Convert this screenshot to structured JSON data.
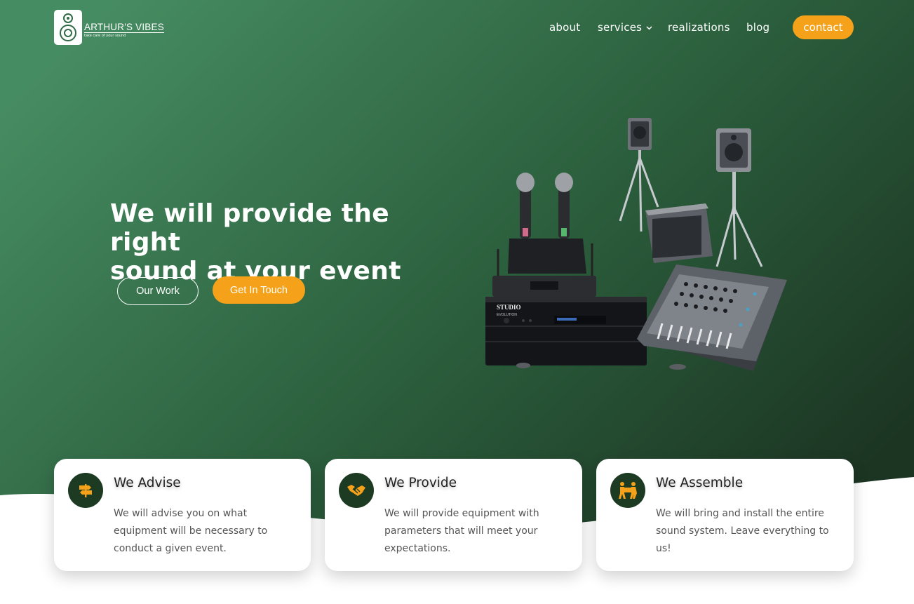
{
  "brand": {
    "name": "ARTHUR'S VIBES",
    "tagline": "take care of your sound",
    "logo_icon": "speaker-icon"
  },
  "nav": {
    "items": [
      {
        "label": "about"
      },
      {
        "label": "services",
        "icon": "chevron-down-icon"
      },
      {
        "label": "realizations"
      },
      {
        "label": "blog"
      }
    ],
    "contact_label": "contact"
  },
  "hero": {
    "title_line1": "We will provide the right",
    "title_line2": "sound at your event",
    "primary_button": "Our Work",
    "secondary_button": "Get In Touch",
    "image": {
      "speaker_brand": "STUDIO",
      "amp_brand": "EVOLUTION"
    }
  },
  "features": [
    {
      "title": "We Advise",
      "text": "We will advise you on what equipment will be necessary to conduct a given event.",
      "icon": "signpost-icon"
    },
    {
      "title": "We Provide",
      "text": "We will provide equipment with parameters that will meet your expectations.",
      "icon": "handshake-icon"
    },
    {
      "title": "We Assemble",
      "text": "We will bring and install the entire sound system. Leave everything to us!",
      "icon": "movers-icon"
    }
  ],
  "colors": {
    "hero_gradient_start": "#468c62",
    "hero_gradient_end": "#1c3523",
    "accent": "#f5a11a",
    "icon_bg": "#1d3a22",
    "page_bg": "#ffffff"
  }
}
